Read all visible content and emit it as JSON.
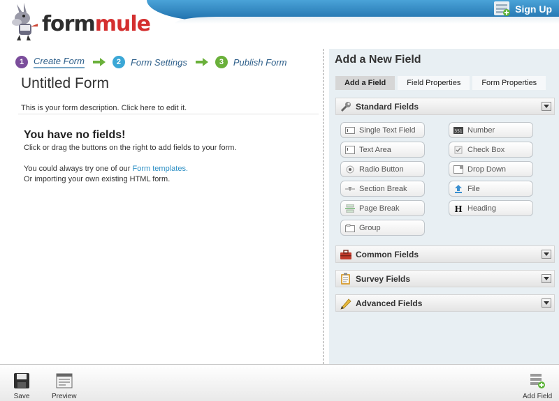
{
  "header": {
    "logo_form": "form",
    "logo_mule": "mule",
    "signup_label": "Sign Up",
    "signup_icon": "user-add-icon"
  },
  "steps": [
    {
      "num": "1",
      "label": "Create Form"
    },
    {
      "num": "2",
      "label": "Form Settings"
    },
    {
      "num": "3",
      "label": "Publish Form"
    }
  ],
  "form": {
    "title": "Untitled Form",
    "description": "This is your form description. Click here to edit it."
  },
  "empty": {
    "title": "You have no fields!",
    "hint": "Click or drag the buttons on the right to add fields to your form.",
    "templates_prefix": "You could always try one of our ",
    "templates_link": "Form templates.",
    "import_text": "Or importing your own existing HTML form."
  },
  "panel": {
    "title": "Add a New Field",
    "tabs": [
      "Add a Field",
      "Field Properties",
      "Form Properties"
    ],
    "active_tab": "Add a Field",
    "sections": [
      "Standard Fields",
      "Common Fields",
      "Survey Fields",
      "Advanced Fields"
    ],
    "standard_fields": [
      "Single Text Field",
      "Number",
      "Text Area",
      "Check Box",
      "Radio Button",
      "Drop Down",
      "Section Break",
      "File",
      "Page Break",
      "Heading",
      "Group"
    ]
  },
  "toolbar": {
    "save": "Save",
    "preview": "Preview",
    "add_field": "Add Field"
  },
  "colors": {
    "header_blue": "#1f6fab",
    "link": "#2a8ec4",
    "panel_bg": "#e8eff3",
    "logo_red": "#d42f2f"
  }
}
